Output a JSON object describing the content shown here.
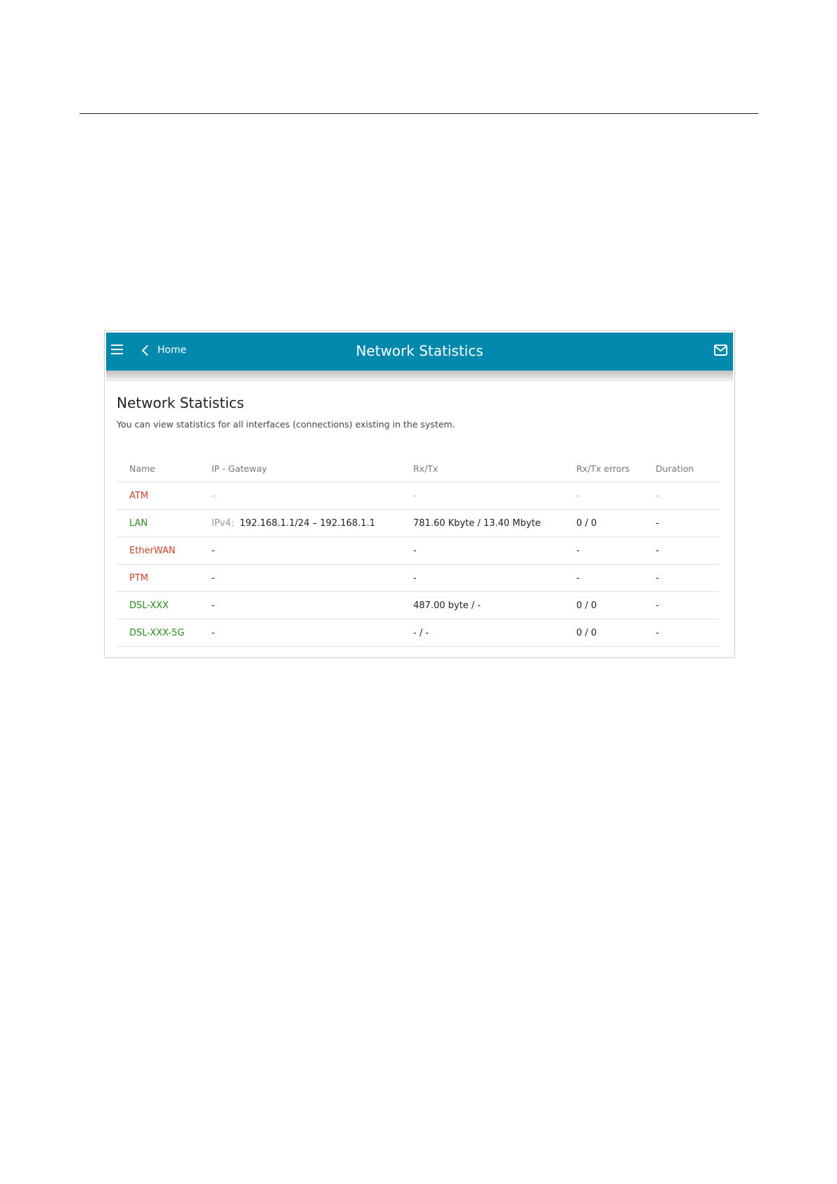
{
  "topbar": {
    "back_label": "Home",
    "title": "Network Statistics"
  },
  "content": {
    "title": "Network Statistics",
    "description": "You can view statistics for all interfaces (connections) existing in the system."
  },
  "table": {
    "headers": {
      "name": "Name",
      "ip_gateway": "IP - Gateway",
      "rxtx": "Rx/Tx",
      "rxtx_errors": "Rx/Tx errors",
      "duration": "Duration"
    },
    "rows": [
      {
        "name": "ATM",
        "status": "down",
        "ip_prefix": "",
        "ip_gateway": "-",
        "rxtx": "-",
        "rxtx_errors": "-",
        "duration": "-"
      },
      {
        "name": "LAN",
        "status": "up",
        "ip_prefix": "IPv4:",
        "ip_gateway": "192.168.1.1/24 – 192.168.1.1",
        "rxtx": "781.60 Kbyte / 13.40 Mbyte",
        "rxtx_errors": "0 / 0",
        "duration": "-"
      },
      {
        "name": "EtherWAN",
        "status": "down",
        "ip_prefix": "",
        "ip_gateway": "-",
        "rxtx": "-",
        "rxtx_errors": "-",
        "duration": "-"
      },
      {
        "name": "PTM",
        "status": "down",
        "ip_prefix": "",
        "ip_gateway": "-",
        "rxtx": "-",
        "rxtx_errors": "-",
        "duration": "-"
      },
      {
        "name": "DSL-XXX",
        "status": "up",
        "ip_prefix": "",
        "ip_gateway": "-",
        "rxtx": "487.00 byte / -",
        "rxtx_errors": "0 / 0",
        "duration": "-"
      },
      {
        "name": "DSL-XXX-5G",
        "status": "up",
        "ip_prefix": "",
        "ip_gateway": "-",
        "rxtx": "- / -",
        "rxtx_errors": "0 / 0",
        "duration": "-"
      }
    ]
  },
  "colors": {
    "topbar": "#0089ad",
    "status_down": "#c8452c",
    "status_up": "#2c8c1f"
  },
  "icons": {
    "menu": "hamburger-menu-icon",
    "back": "chevron-left-icon",
    "notifications": "mail-icon"
  }
}
